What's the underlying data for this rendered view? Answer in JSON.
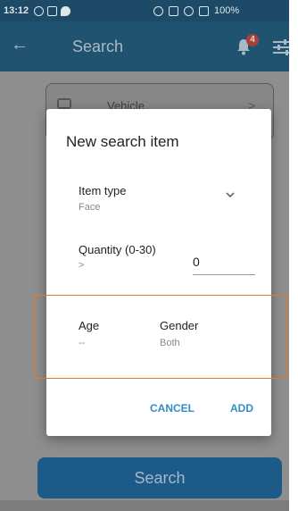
{
  "status_bar": {
    "time": "13:12",
    "battery": "100%"
  },
  "app_bar": {
    "back_icon": "arrow-left-icon",
    "title": "Search",
    "notification_count": "4",
    "filter_icon": "tune-icon"
  },
  "background": {
    "vehicle_label": "Vehicle",
    "vehicle_chevron": ">",
    "search_button_label": "Search"
  },
  "dialog": {
    "title": "New search item",
    "item_type": {
      "label": "Item type",
      "value": "Face"
    },
    "quantity": {
      "label": "Quantity (0-30)",
      "sub": ">",
      "value": "0"
    },
    "age": {
      "label": "Age",
      "value": "--"
    },
    "gender": {
      "label": "Gender",
      "value": "Both"
    },
    "cancel_label": "CANCEL",
    "add_label": "ADD"
  },
  "colors": {
    "accent": "#2f8ec6",
    "highlight": "#e07a28",
    "app_bar": "#20536f"
  }
}
